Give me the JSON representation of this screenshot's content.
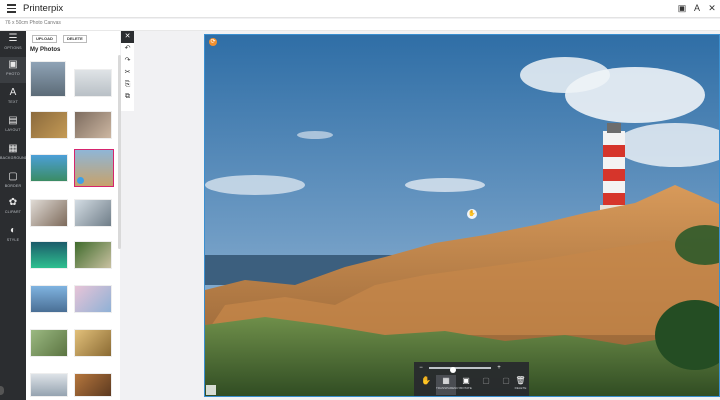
{
  "header": {
    "brand": "Printerpix",
    "subtitle": "76 x 50cm Photo Canvas",
    "icons": [
      "hamburger-icon",
      "image-icon",
      "font-icon",
      "tools-icon"
    ]
  },
  "rail": {
    "items": [
      {
        "name": "options",
        "label": "Options",
        "glyph": "☰"
      },
      {
        "name": "photo",
        "label": "Photo",
        "glyph": "▣"
      },
      {
        "name": "text",
        "label": "Text",
        "glyph": "A"
      },
      {
        "name": "layout",
        "label": "Layout",
        "glyph": "▤"
      },
      {
        "name": "backgrounds",
        "label": "Backgrounds",
        "glyph": "▦"
      },
      {
        "name": "border",
        "label": "Border",
        "glyph": "▢"
      },
      {
        "name": "clipart",
        "label": "Clipart",
        "glyph": "✿"
      },
      {
        "name": "style",
        "label": "Style",
        "glyph": "◐"
      }
    ]
  },
  "photos_panel": {
    "upload_label": "UPLOAD",
    "delete_label": "DELETE",
    "title": "My Photos"
  },
  "tools": {
    "glyphs": [
      "✕",
      "↶",
      "↷",
      "✂",
      "⎘",
      "⧉"
    ]
  },
  "colors": {
    "accent": "#d6246e",
    "frame": "#3a8fd0",
    "badge": "#f18f2e",
    "rail": "#2b2d30"
  },
  "photo_toolbar": {
    "items": [
      {
        "label": "Transparency",
        "glyph": "▦"
      },
      {
        "label": "Rotate",
        "glyph": "▣"
      },
      {
        "label": "",
        "glyph": "▢"
      },
      {
        "label": "",
        "glyph": "▢"
      },
      {
        "label": "Delete",
        "glyph": "🗑"
      }
    ]
  }
}
